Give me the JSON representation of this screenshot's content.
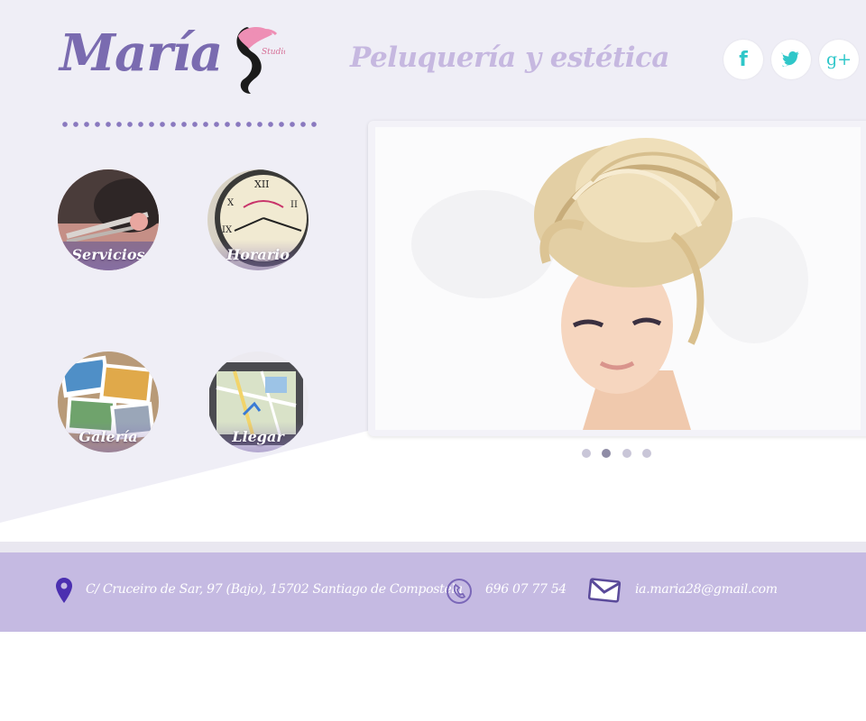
{
  "header": {
    "brand": "María",
    "logo_text": "Studio",
    "tagline": "Peluquería y estética"
  },
  "social": {
    "items": [
      {
        "name": "facebook",
        "glyph": "f",
        "color": "#2fc7c9"
      },
      {
        "name": "twitter",
        "glyph": "",
        "color": "#2fc7c9"
      },
      {
        "name": "google-plus",
        "glyph": "g+",
        "color": "#2fc7c9"
      }
    ]
  },
  "menu": {
    "items": [
      {
        "label": "Servicios"
      },
      {
        "label": "Horario"
      },
      {
        "label": "Galería"
      },
      {
        "label": "Llegar"
      }
    ]
  },
  "slider": {
    "slide_count": 4,
    "active_index": 1
  },
  "footer": {
    "address": "C/ Cruceiro de Sar, 97 (Bajo), 15702 Santiago de Compostela",
    "phone": "696 07 77 54",
    "email": "ia.maria28@gmail.com"
  },
  "colors": {
    "brand_purple": "#7a6bb0",
    "tagline_lilac": "#c6b8e0",
    "footer_bg": "#c5bae2",
    "social_teal": "#2fc7c9"
  }
}
